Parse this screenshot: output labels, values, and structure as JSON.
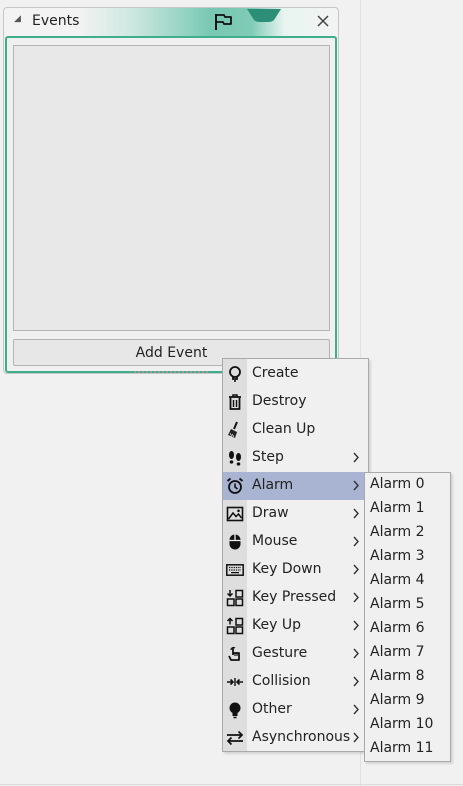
{
  "panel": {
    "title": "Events",
    "add_event_label": "Add Event"
  },
  "colors": {
    "accent": "#3fae8d",
    "highlight": "#a8b4d2"
  },
  "menu": {
    "items": [
      {
        "label": "Create",
        "icon": "lightbulb-icon",
        "submenu": false
      },
      {
        "label": "Destroy",
        "icon": "trash-icon",
        "submenu": false
      },
      {
        "label": "Clean Up",
        "icon": "broom-icon",
        "submenu": false
      },
      {
        "label": "Step",
        "icon": "footsteps-icon",
        "submenu": true
      },
      {
        "label": "Alarm",
        "icon": "alarm-clock-icon",
        "submenu": true,
        "highlighted": true
      },
      {
        "label": "Draw",
        "icon": "picture-icon",
        "submenu": true
      },
      {
        "label": "Mouse",
        "icon": "mouse-icon",
        "submenu": true
      },
      {
        "label": "Key Down",
        "icon": "keyboard-icon",
        "submenu": true
      },
      {
        "label": "Key Pressed",
        "icon": "key-pressed-icon",
        "submenu": true
      },
      {
        "label": "Key Up",
        "icon": "key-up-icon",
        "submenu": true
      },
      {
        "label": "Gesture",
        "icon": "touch-icon",
        "submenu": true
      },
      {
        "label": "Collision",
        "icon": "collision-icon",
        "submenu": true
      },
      {
        "label": "Other",
        "icon": "bulb-icon",
        "submenu": true
      },
      {
        "label": "Asynchronous",
        "icon": "swap-arrows-icon",
        "submenu": true
      }
    ]
  },
  "alarm_submenu": {
    "items": [
      "Alarm 0",
      "Alarm 1",
      "Alarm 2",
      "Alarm 3",
      "Alarm 4",
      "Alarm 5",
      "Alarm 6",
      "Alarm 7",
      "Alarm 8",
      "Alarm 9",
      "Alarm 10",
      "Alarm 11"
    ]
  }
}
